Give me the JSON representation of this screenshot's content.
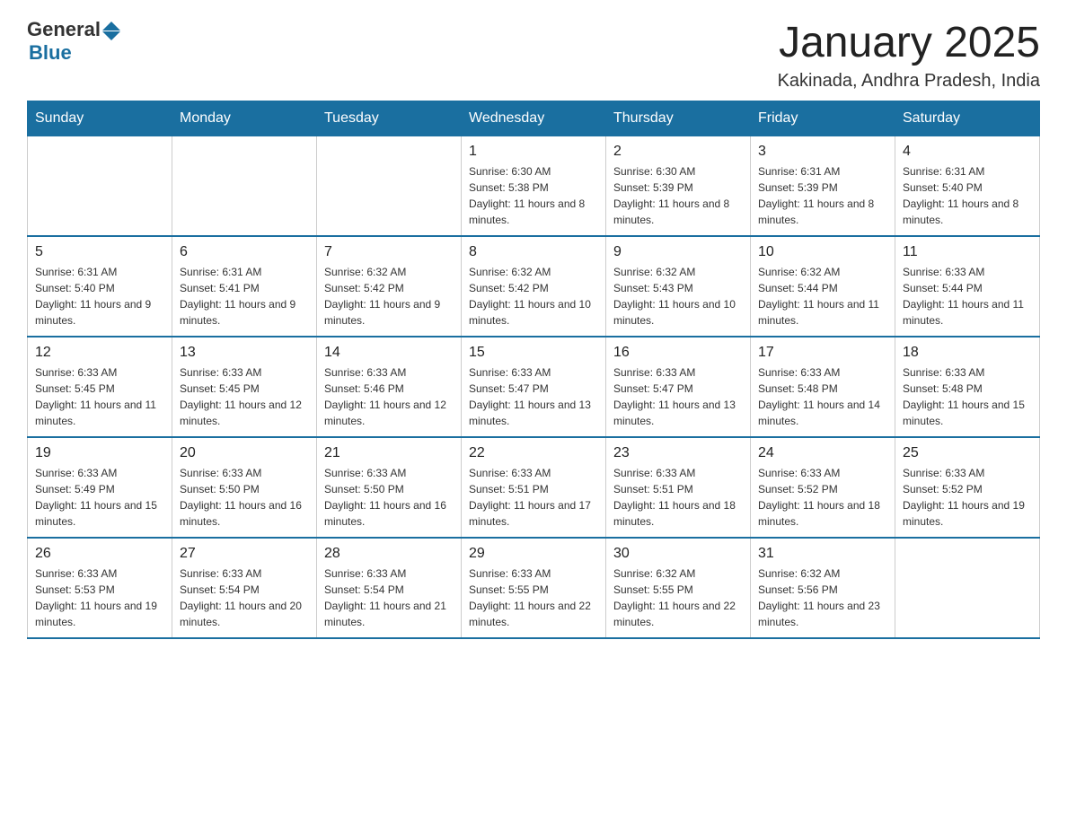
{
  "logo": {
    "text_general": "General",
    "text_blue": "Blue"
  },
  "title": "January 2025",
  "subtitle": "Kakinada, Andhra Pradesh, India",
  "days_of_week": [
    "Sunday",
    "Monday",
    "Tuesday",
    "Wednesday",
    "Thursday",
    "Friday",
    "Saturday"
  ],
  "weeks": [
    [
      {
        "day": "",
        "info": ""
      },
      {
        "day": "",
        "info": ""
      },
      {
        "day": "",
        "info": ""
      },
      {
        "day": "1",
        "info": "Sunrise: 6:30 AM\nSunset: 5:38 PM\nDaylight: 11 hours and 8 minutes."
      },
      {
        "day": "2",
        "info": "Sunrise: 6:30 AM\nSunset: 5:39 PM\nDaylight: 11 hours and 8 minutes."
      },
      {
        "day": "3",
        "info": "Sunrise: 6:31 AM\nSunset: 5:39 PM\nDaylight: 11 hours and 8 minutes."
      },
      {
        "day": "4",
        "info": "Sunrise: 6:31 AM\nSunset: 5:40 PM\nDaylight: 11 hours and 8 minutes."
      }
    ],
    [
      {
        "day": "5",
        "info": "Sunrise: 6:31 AM\nSunset: 5:40 PM\nDaylight: 11 hours and 9 minutes."
      },
      {
        "day": "6",
        "info": "Sunrise: 6:31 AM\nSunset: 5:41 PM\nDaylight: 11 hours and 9 minutes."
      },
      {
        "day": "7",
        "info": "Sunrise: 6:32 AM\nSunset: 5:42 PM\nDaylight: 11 hours and 9 minutes."
      },
      {
        "day": "8",
        "info": "Sunrise: 6:32 AM\nSunset: 5:42 PM\nDaylight: 11 hours and 10 minutes."
      },
      {
        "day": "9",
        "info": "Sunrise: 6:32 AM\nSunset: 5:43 PM\nDaylight: 11 hours and 10 minutes."
      },
      {
        "day": "10",
        "info": "Sunrise: 6:32 AM\nSunset: 5:44 PM\nDaylight: 11 hours and 11 minutes."
      },
      {
        "day": "11",
        "info": "Sunrise: 6:33 AM\nSunset: 5:44 PM\nDaylight: 11 hours and 11 minutes."
      }
    ],
    [
      {
        "day": "12",
        "info": "Sunrise: 6:33 AM\nSunset: 5:45 PM\nDaylight: 11 hours and 11 minutes."
      },
      {
        "day": "13",
        "info": "Sunrise: 6:33 AM\nSunset: 5:45 PM\nDaylight: 11 hours and 12 minutes."
      },
      {
        "day": "14",
        "info": "Sunrise: 6:33 AM\nSunset: 5:46 PM\nDaylight: 11 hours and 12 minutes."
      },
      {
        "day": "15",
        "info": "Sunrise: 6:33 AM\nSunset: 5:47 PM\nDaylight: 11 hours and 13 minutes."
      },
      {
        "day": "16",
        "info": "Sunrise: 6:33 AM\nSunset: 5:47 PM\nDaylight: 11 hours and 13 minutes."
      },
      {
        "day": "17",
        "info": "Sunrise: 6:33 AM\nSunset: 5:48 PM\nDaylight: 11 hours and 14 minutes."
      },
      {
        "day": "18",
        "info": "Sunrise: 6:33 AM\nSunset: 5:48 PM\nDaylight: 11 hours and 15 minutes."
      }
    ],
    [
      {
        "day": "19",
        "info": "Sunrise: 6:33 AM\nSunset: 5:49 PM\nDaylight: 11 hours and 15 minutes."
      },
      {
        "day": "20",
        "info": "Sunrise: 6:33 AM\nSunset: 5:50 PM\nDaylight: 11 hours and 16 minutes."
      },
      {
        "day": "21",
        "info": "Sunrise: 6:33 AM\nSunset: 5:50 PM\nDaylight: 11 hours and 16 minutes."
      },
      {
        "day": "22",
        "info": "Sunrise: 6:33 AM\nSunset: 5:51 PM\nDaylight: 11 hours and 17 minutes."
      },
      {
        "day": "23",
        "info": "Sunrise: 6:33 AM\nSunset: 5:51 PM\nDaylight: 11 hours and 18 minutes."
      },
      {
        "day": "24",
        "info": "Sunrise: 6:33 AM\nSunset: 5:52 PM\nDaylight: 11 hours and 18 minutes."
      },
      {
        "day": "25",
        "info": "Sunrise: 6:33 AM\nSunset: 5:52 PM\nDaylight: 11 hours and 19 minutes."
      }
    ],
    [
      {
        "day": "26",
        "info": "Sunrise: 6:33 AM\nSunset: 5:53 PM\nDaylight: 11 hours and 19 minutes."
      },
      {
        "day": "27",
        "info": "Sunrise: 6:33 AM\nSunset: 5:54 PM\nDaylight: 11 hours and 20 minutes."
      },
      {
        "day": "28",
        "info": "Sunrise: 6:33 AM\nSunset: 5:54 PM\nDaylight: 11 hours and 21 minutes."
      },
      {
        "day": "29",
        "info": "Sunrise: 6:33 AM\nSunset: 5:55 PM\nDaylight: 11 hours and 22 minutes."
      },
      {
        "day": "30",
        "info": "Sunrise: 6:32 AM\nSunset: 5:55 PM\nDaylight: 11 hours and 22 minutes."
      },
      {
        "day": "31",
        "info": "Sunrise: 6:32 AM\nSunset: 5:56 PM\nDaylight: 11 hours and 23 minutes."
      },
      {
        "day": "",
        "info": ""
      }
    ]
  ]
}
